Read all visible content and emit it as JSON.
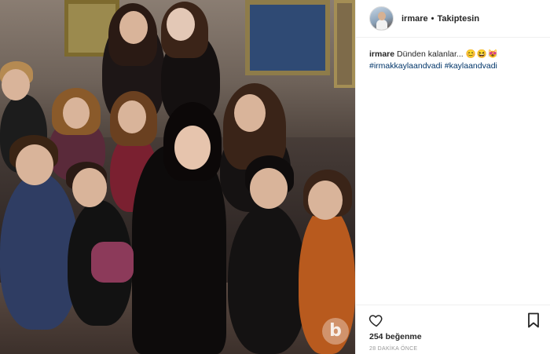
{
  "photo": {
    "watermark_letter": "b",
    "watermark_color": "#ffffff"
  },
  "header": {
    "username": "irmare",
    "separator": "•",
    "follow_label": "Takiptesin"
  },
  "caption": {
    "username": "irmare",
    "text": "Dünden kalanlar...",
    "emojis": "😊😆😻",
    "hashtags": [
      "#irmakkaylaandvadi",
      "#kaylaandvadi"
    ]
  },
  "actions": {
    "like_icon": "heart-icon",
    "save_icon": "bookmark-icon",
    "likes_count": "254",
    "likes_label": "beğenme",
    "timestamp": "28 DAKİKA ÖNCE"
  },
  "colors": {
    "hashtag": "#003569",
    "text": "#262626",
    "muted": "#999999",
    "divider": "#efefef"
  }
}
